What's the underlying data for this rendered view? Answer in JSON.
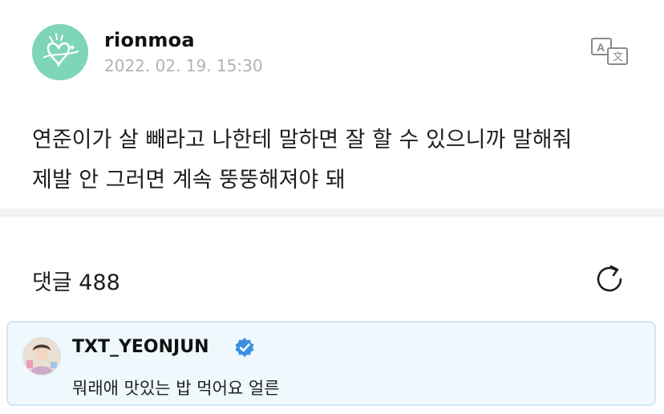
{
  "post": {
    "author": "rionmoa",
    "timestamp": "2022. 02. 19. 15:30",
    "body_line1": "연준이가 살 빼라고 나한테 말하면 잘 할 수 있으니까 말해줘",
    "body_line2": "제발 안 그러면 계속 뚱뚱해져야 돼",
    "avatar_color": "#7fd6b7",
    "translate_icon": "translate-icon"
  },
  "comments": {
    "title": "댓글 488",
    "refresh_icon": "refresh-icon",
    "highlight": {
      "author": "TXT_YEONJUN",
      "verified_icon": "verified-badge-icon",
      "verified_color": "#3b8fe3",
      "text": "뭐래애 맛있는 밥 먹어요 얼른",
      "background": "#eef8fd"
    }
  }
}
